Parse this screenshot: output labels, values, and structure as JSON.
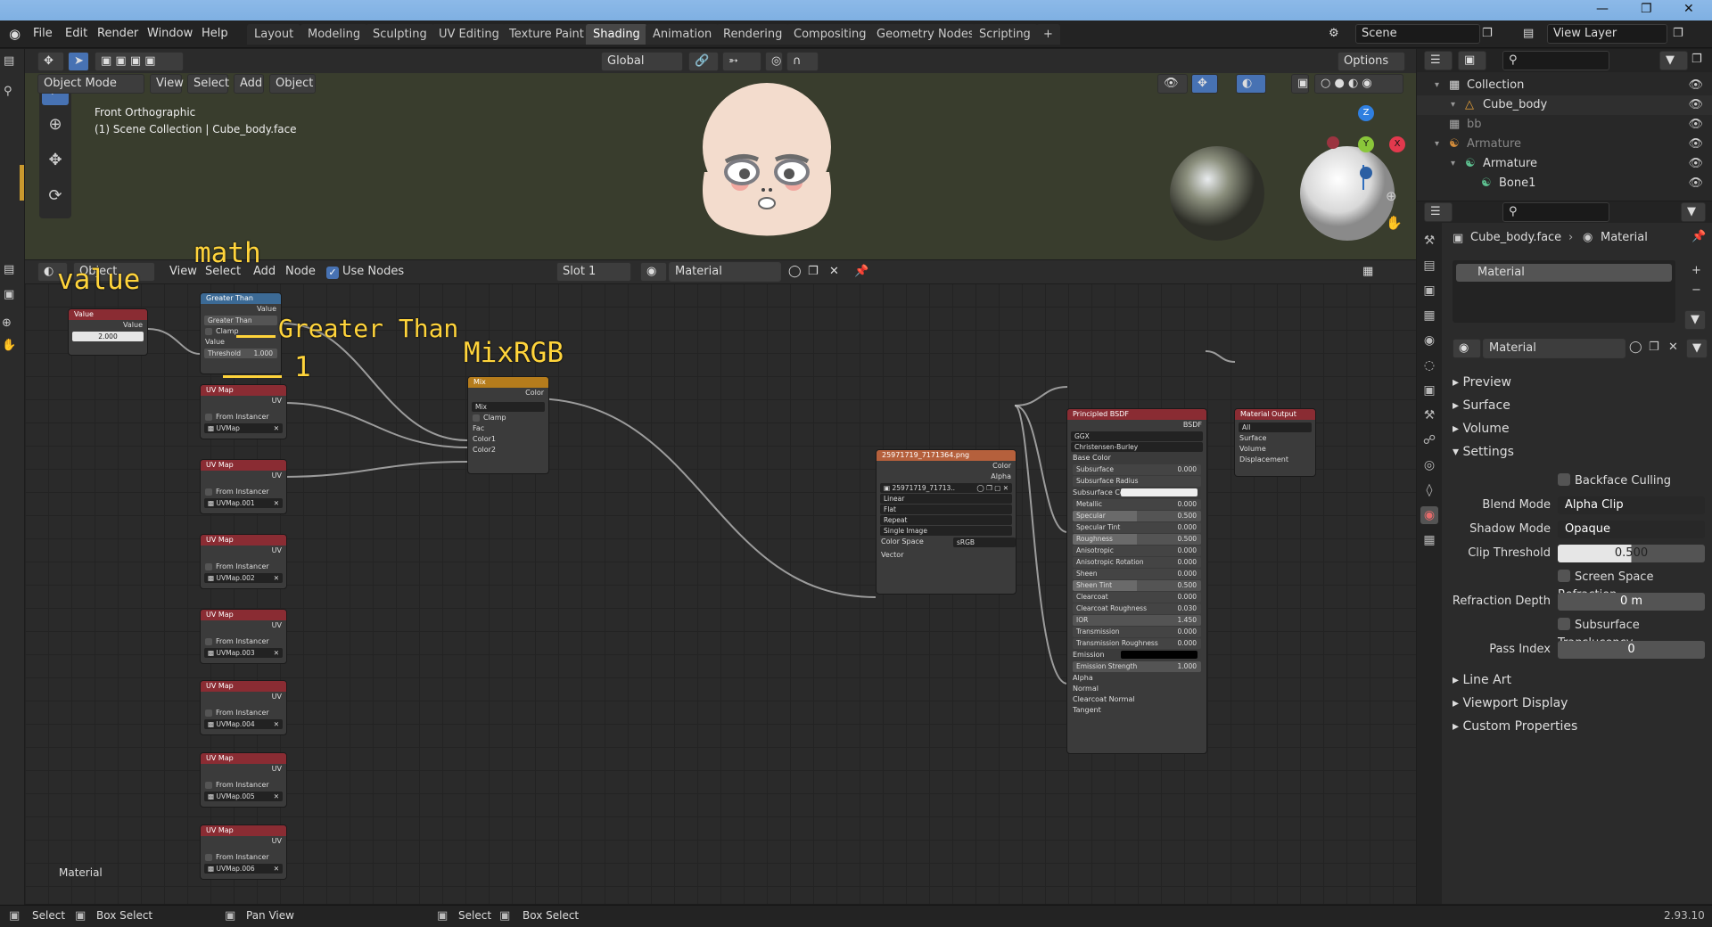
{
  "topbar": {
    "menus": [
      "File",
      "Edit",
      "Render",
      "Window",
      "Help"
    ],
    "workspaces": [
      "Layout",
      "Modeling",
      "Sculpting",
      "UV Editing",
      "Texture Paint",
      "Shading",
      "Animation",
      "Rendering",
      "Compositing",
      "Geometry Nodes",
      "Scripting"
    ],
    "active_workspace": "Shading",
    "add_tab": "+",
    "scene": "Scene",
    "view_layer": "View Layer"
  },
  "viewport": {
    "mode": "Object Mode",
    "menus": [
      "View",
      "Select",
      "Add",
      "Object"
    ],
    "transform": "Global",
    "options": "Options",
    "view_name": "Front Orthographic",
    "collection_info": "(1) Scene Collection | Cube_body.face",
    "gizmo": {
      "z": "Z",
      "y": "Y",
      "x": "X"
    }
  },
  "node_editor": {
    "type_label": "Object",
    "menus": [
      "View",
      "Select",
      "Add",
      "Node"
    ],
    "use_nodes": "Use Nodes",
    "slot": "Slot 1",
    "material": "Material",
    "footer_label": "Material"
  },
  "annotations": {
    "value": "value",
    "math": "math",
    "greater": "Greater Than",
    "one": "1",
    "mixrgb": "MixRGB"
  },
  "nodes": {
    "value": {
      "title": "Value",
      "out": "Value",
      "val": "2.000"
    },
    "math": {
      "title": "Greater Than",
      "out": "Value",
      "op": "Greater Than",
      "clamp": "Clamp",
      "in": "Value",
      "thr_label": "Threshold",
      "thr": "1.000"
    },
    "uvmap": {
      "title": "UV Map",
      "out": "UV",
      "from": "From Instancer",
      "maps": [
        "UVMap",
        "UVMap.001",
        "UVMap.002",
        "UVMap.003",
        "UVMap.004",
        "UVMap.005",
        "UVMap.006"
      ]
    },
    "mix": {
      "title": "Mix",
      "out": "Color",
      "blend": "Mix",
      "clamp": "Clamp",
      "fac": "Fac",
      "c1": "Color1",
      "c2": "Color2"
    },
    "image": {
      "title": "25971719_7171364.png",
      "color": "Color",
      "alpha": "Alpha",
      "img": "25971719_71713..",
      "interp": "Linear",
      "proj": "Flat",
      "ext": "Repeat",
      "src": "Single Image",
      "cs_label": "Color Space",
      "cs": "sRGB",
      "vector": "Vector"
    },
    "bsdf": {
      "title": "Principled BSDF",
      "out": "BSDF",
      "dist": "GGX",
      "sss": "Christensen-Burley",
      "rows": [
        [
          "Base Color",
          ""
        ],
        [
          "Subsurface",
          "0.000"
        ],
        [
          "Subsurface Radius",
          ""
        ],
        [
          "Subsurface Co...",
          ""
        ],
        [
          "Metallic",
          "0.000"
        ],
        [
          "Specular",
          "0.500"
        ],
        [
          "Specular Tint",
          "0.000"
        ],
        [
          "Roughness",
          "0.500"
        ],
        [
          "Anisotropic",
          "0.000"
        ],
        [
          "Anisotropic Rotation",
          "0.000"
        ],
        [
          "Sheen",
          "0.000"
        ],
        [
          "Sheen Tint",
          "0.500"
        ],
        [
          "Clearcoat",
          "0.000"
        ],
        [
          "Clearcoat Roughness",
          "0.030"
        ],
        [
          "IOR",
          "1.450"
        ],
        [
          "Transmission",
          "0.000"
        ],
        [
          "Transmission Roughness",
          "0.000"
        ],
        [
          "Emission",
          ""
        ],
        [
          "Emission Strength",
          "1.000"
        ],
        [
          "Alpha",
          ""
        ],
        [
          "Normal",
          ""
        ],
        [
          "Clearcoat Normal",
          ""
        ],
        [
          "Tangent",
          ""
        ]
      ]
    },
    "output": {
      "title": "Material Output",
      "target": "All",
      "surface": "Surface",
      "volume": "Volume",
      "disp": "Displacement"
    }
  },
  "outliner": {
    "rows": [
      {
        "label": "Collection",
        "indent": 1
      },
      {
        "label": "Cube_body",
        "indent": 2
      },
      {
        "label": "bb",
        "indent": 1
      },
      {
        "label": "Armature",
        "indent": 1
      },
      {
        "label": "Armature",
        "indent": 2
      },
      {
        "label": "Bone1",
        "indent": 3
      }
    ]
  },
  "properties": {
    "breadcrumb_obj": "Cube_body.face",
    "breadcrumb_mat": "Material",
    "slot_item": "Material",
    "material_name": "Material",
    "panels": [
      "Preview",
      "Surface",
      "Volume",
      "Settings"
    ],
    "settings": {
      "backface": "Backface Culling",
      "blend_label": "Blend Mode",
      "blend": "Alpha Clip",
      "shadow_label": "Shadow Mode",
      "shadow": "Opaque",
      "clip_label": "Clip Threshold",
      "clip": "0.500",
      "ssr": "Screen Space Refraction",
      "refr_label": "Refraction Depth",
      "refr": "0 m",
      "sst": "Subsurface Translucency",
      "pass_label": "Pass Index",
      "pass": "0"
    },
    "more_panels": [
      "Line Art",
      "Viewport Display",
      "Custom Properties"
    ]
  },
  "statusbar": {
    "items": [
      "Select",
      "Box Select",
      "Pan View",
      "Select",
      "Box Select"
    ],
    "version": "2.93.10"
  }
}
